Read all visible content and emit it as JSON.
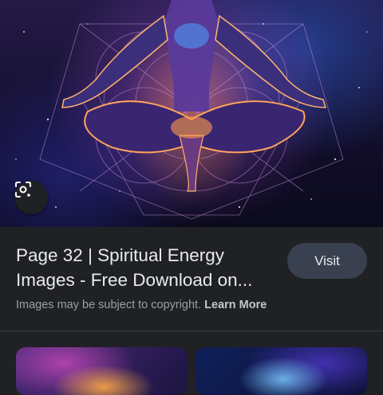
{
  "result": {
    "title": "Page 32 | Spiritual Energy Images - Free Download on...",
    "visit_label": "Visit",
    "copyright_text": "Images may be subject to copyright.",
    "learn_more_label": "Learn More"
  },
  "hero_image": {
    "icon": "lens-search-icon"
  },
  "related_images": [
    {
      "name": "related-image-1"
    },
    {
      "name": "related-image-2"
    }
  ],
  "colors": {
    "background": "#202124",
    "visit_button": "#394150",
    "secondary_text": "#9aa0a6"
  }
}
